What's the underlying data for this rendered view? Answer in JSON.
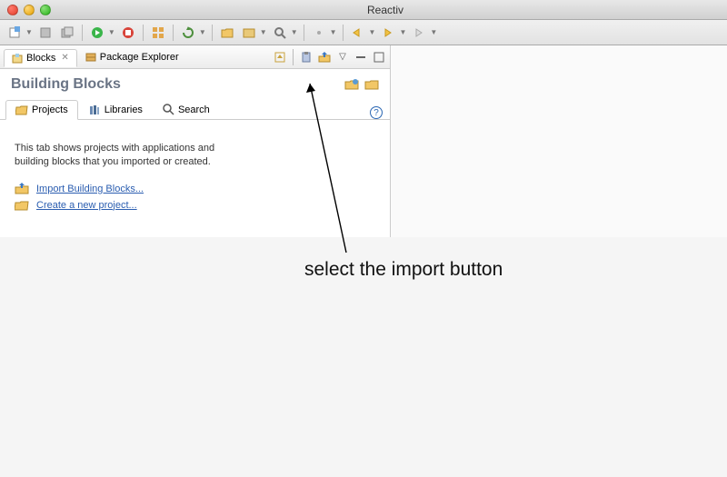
{
  "window": {
    "title": "Reactiv"
  },
  "viewTabs": {
    "blocks": {
      "label": "Blocks"
    },
    "packageExplorer": {
      "label": "Package Explorer"
    }
  },
  "panel": {
    "heading": "Building Blocks",
    "tabs": {
      "projects": "Projects",
      "libraries": "Libraries",
      "search": "Search"
    },
    "projectsTab": {
      "description": "This tab shows projects with applications and building blocks that you imported or created.",
      "links": {
        "import": "Import Building Blocks...",
        "create": "Create a new project..."
      }
    }
  },
  "icons": {
    "blocks": "blocks-icon",
    "package": "package-icon",
    "folder": "folder-icon",
    "folderOpen": "folder-open-icon",
    "books": "books-icon",
    "search": "search-icon",
    "import": "import-icon",
    "paste": "paste-icon",
    "collapse": "collapse-icon",
    "viewMenu": "view-menu-icon",
    "min": "minimize-icon",
    "max": "maximize-icon"
  },
  "annotation": {
    "text": "select the import button"
  }
}
